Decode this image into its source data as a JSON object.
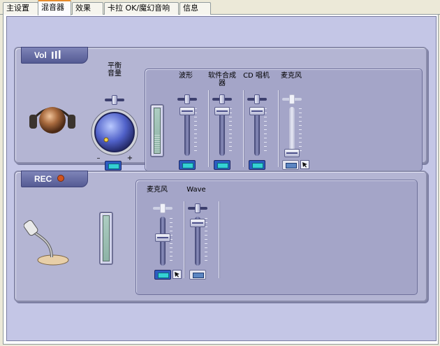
{
  "tabs": [
    {
      "label": "主设置",
      "active": false
    },
    {
      "label": "混音器",
      "active": true
    },
    {
      "label": "效果",
      "active": false
    },
    {
      "label": "卡拉 OK/魔幻音响",
      "active": false
    },
    {
      "label": "信息",
      "active": false
    }
  ],
  "playback": {
    "badge": "Vol",
    "balance_label": "平衡\n音量",
    "balance_minus": "–",
    "balance_plus": "+",
    "channels": [
      {
        "label": "波形",
        "level": 0.85,
        "enabled": true,
        "muted": false
      },
      {
        "label": "软件合成\n器",
        "level": 0.85,
        "enabled": true,
        "muted": false
      },
      {
        "label": "CD 唱机",
        "level": 0.85,
        "enabled": true,
        "muted": false
      },
      {
        "label": "麦克风",
        "level": 0.0,
        "enabled": false,
        "muted": true
      }
    ]
  },
  "record": {
    "badge": "REC",
    "channels": [
      {
        "label": "麦克风",
        "level": 0.55,
        "enabled": true,
        "selected": true
      },
      {
        "label": "Wave",
        "level": 0.9,
        "enabled": true,
        "selected": false
      }
    ]
  },
  "colors": {
    "background": "#c4c6e6",
    "panel": "#b4b5d3",
    "badge": "#555b94",
    "rec_dot": "#d0541f",
    "mute_active": "#34d1d4"
  },
  "icons": {
    "speaker": "speaker-icon",
    "microphone": "microphone-icon",
    "volume_bars": "volume-bars-icon",
    "record_dot": "record-dot-icon"
  }
}
